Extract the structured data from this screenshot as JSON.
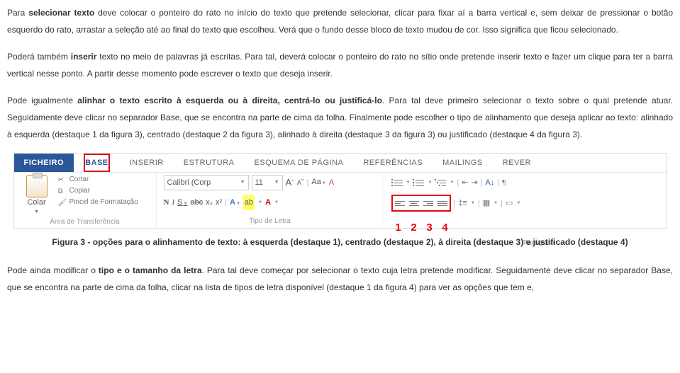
{
  "paragraphs": {
    "p1a": "Para ",
    "p1b": "selecionar texto",
    "p1c": " deve colocar o ponteiro do rato no início do texto que pretende selecionar, clicar para fixar aí a barra vertical e, sem deixar de pressionar o botão esquerdo do rato, arrastar a seleção até ao final do texto que escolheu. Verá que o fundo desse bloco de texto mudou de cor. Isso significa que ficou selecionado.",
    "p2a": "Poderá também ",
    "p2b": "inserir",
    "p2c": " texto no meio de palavras já escritas. Para tal, deverá colocar o ponteiro do rato no sítio onde pretende inserir texto e fazer um clique para ter a barra vertical nesse ponto. A partir desse momento pode escrever o texto que deseja inserir.",
    "p3a": "Pode igualmente ",
    "p3b": "alinhar o texto escrito à esquerda ou à direita, centrá-lo ou justificá-lo",
    "p3c": ". Para tal deve primeiro selecionar o texto sobre o qual pretende atuar. Seguidamente deve clicar no separador Base, que se encontra na parte de cima da folha. Finalmente pode escolher o tipo de alinhamento que deseja aplicar ao texto: alinhado à esquerda (destaque 1 da figura 3), centrado (destaque 2 da figura 3), alinhado à direita (destaque 3 da figura 3) ou justificado (destaque 4 da figura 3).",
    "caption": "Figura 3 - opções para o alinhamento de texto: à esquerda (destaque 1), centrado (destaque 2), à direita (destaque 3) e justificado (destaque 4)",
    "p4a": "Pode ainda modificar o ",
    "p4b": "tipo e o tamanho da letra",
    "p4c": ". Para tal deve começar por selecionar o texto cuja letra pretende modificar. Seguidamente deve clicar no separador Base, que se encontra na parte de cima da folha, clicar na lista de tipos de letra disponível (destaque 1 da figura 4) para ver as opções que tem e,"
  },
  "ribbon": {
    "tabs": {
      "file": "FICHEIRO",
      "base": "BASE",
      "inserir": "INSERIR",
      "estrutura": "ESTRUTURA",
      "esquema": "ESQUEMA DE PÁGINA",
      "referencias": "REFERÊNCIAS",
      "mailings": "MAILINGS",
      "rever": "REVER"
    },
    "clipboard": {
      "paste": "Colar",
      "cut": "Cortar",
      "copy": "Copiar",
      "formatpainter": "Pincel de Formatação",
      "group": "Área de Transferência"
    },
    "font": {
      "name": "Calibri (Corp",
      "size": "11",
      "bold": "N",
      "italic": "I",
      "underline": "S",
      "strike": "abc",
      "sub": "x₂",
      "sup": "x²",
      "growA": "A",
      "shrinkA": "A",
      "caseAa": "Aa",
      "clearA": "A",
      "colorA": "A",
      "group": "Tipo de Letra"
    },
    "paragraph": {
      "group": "Parágrafo",
      "nums": {
        "n1": "1",
        "n2": "2",
        "n3": "3",
        "n4": "4"
      }
    }
  }
}
